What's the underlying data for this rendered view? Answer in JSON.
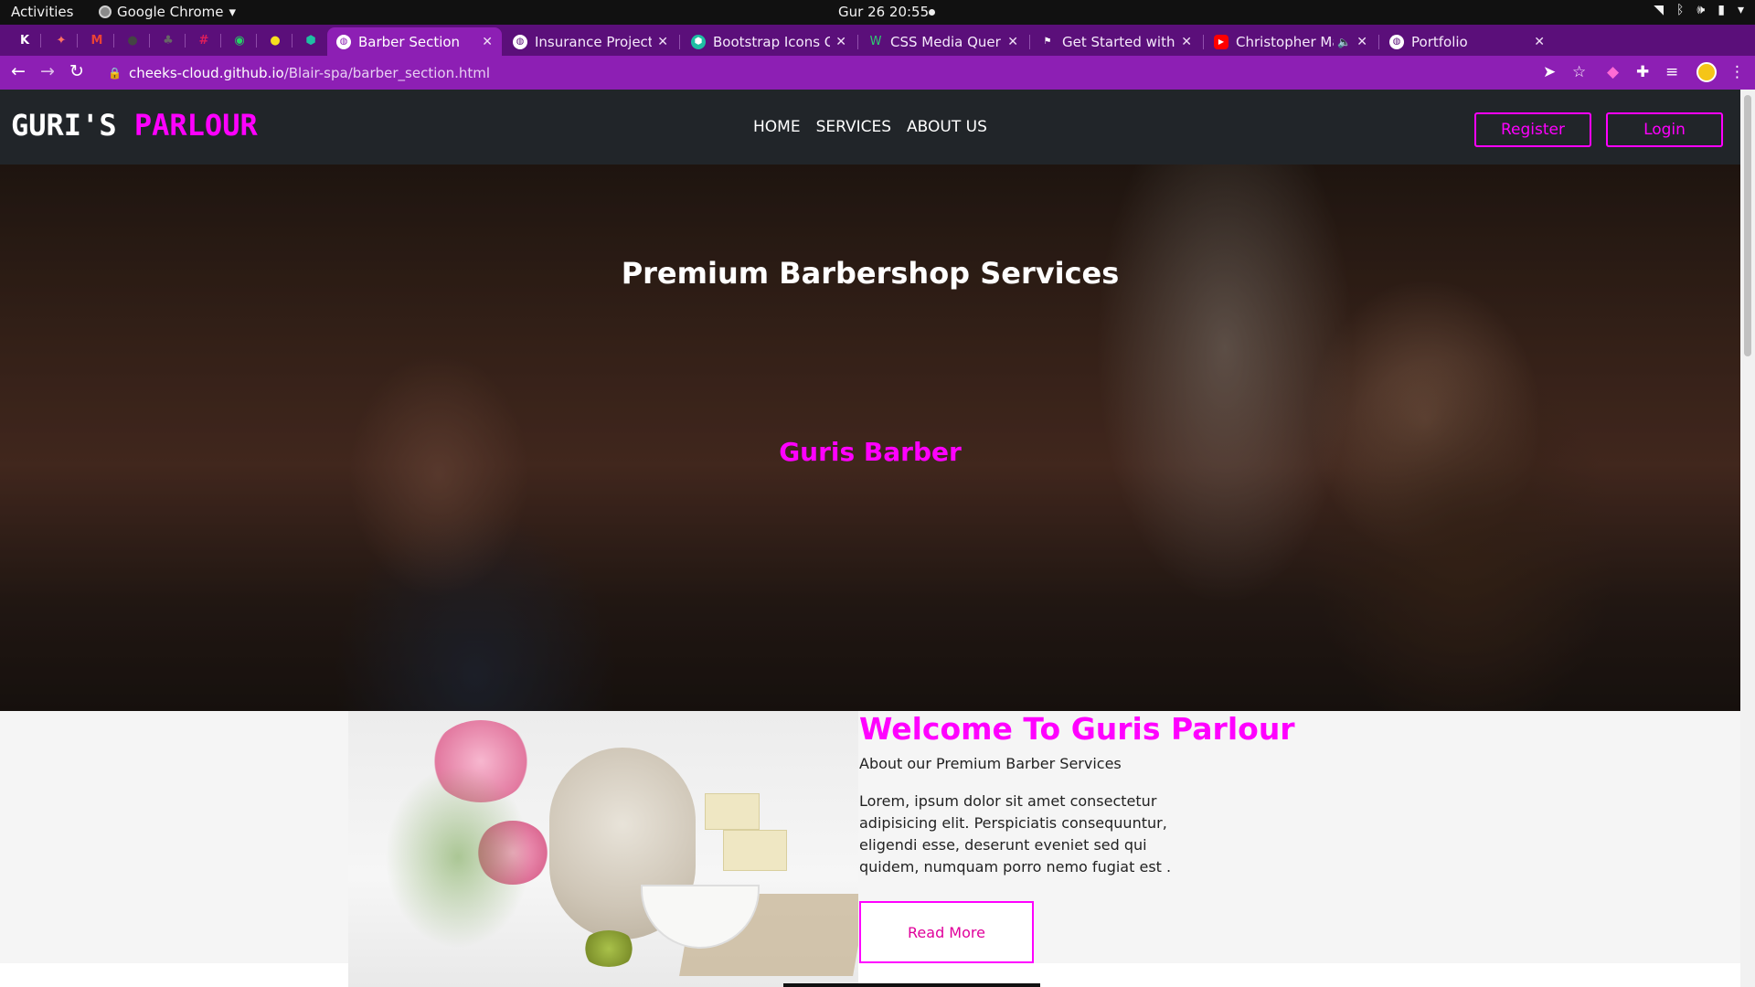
{
  "gnome": {
    "activities": "Activities",
    "app_name": "Google Chrome",
    "clock": "Gur 26  20:55"
  },
  "tabs": [
    {
      "title": "Barber Section",
      "active": true
    },
    {
      "title": "Insurance Project",
      "active": false
    },
    {
      "title": "Bootstrap Icons Cl",
      "active": false
    },
    {
      "title": "CSS Media Queries",
      "active": false
    },
    {
      "title": "Get Started with F",
      "active": false
    },
    {
      "title": "Christopher Ma",
      "active": false
    },
    {
      "title": "Portfolio",
      "active": false
    }
  ],
  "address_bar": {
    "host": "cheeks-cloud.github.io",
    "path": "/Blair-spa/barber_section.html"
  },
  "site": {
    "brand_part1": "GURI'S",
    "brand_part2": "PARLOUR",
    "nav": [
      "HOME",
      "SERVICES",
      "ABOUT US"
    ],
    "register_label": "Register",
    "login_label": "Login",
    "hero_title": "Premium Barbershop Services",
    "hero_subtitle": "Guris Barber",
    "welcome_title": "Welcome To Guris Parlour",
    "welcome_subtitle": "About our Premium Barber Services",
    "welcome_body": "Lorem, ipsum dolor sit amet consectetur adipisicing elit. Perspiciatis consequuntur, eligendi esse, deserunt eveniet sed qui quidem, numquam porro nemo fugiat est .",
    "read_more_label": "Read More"
  },
  "colors": {
    "accent": "#ff00ff",
    "navbar": "#212529",
    "chrome_frame": "#5b0f7a",
    "chrome_toolbar": "#8d1fb4"
  }
}
